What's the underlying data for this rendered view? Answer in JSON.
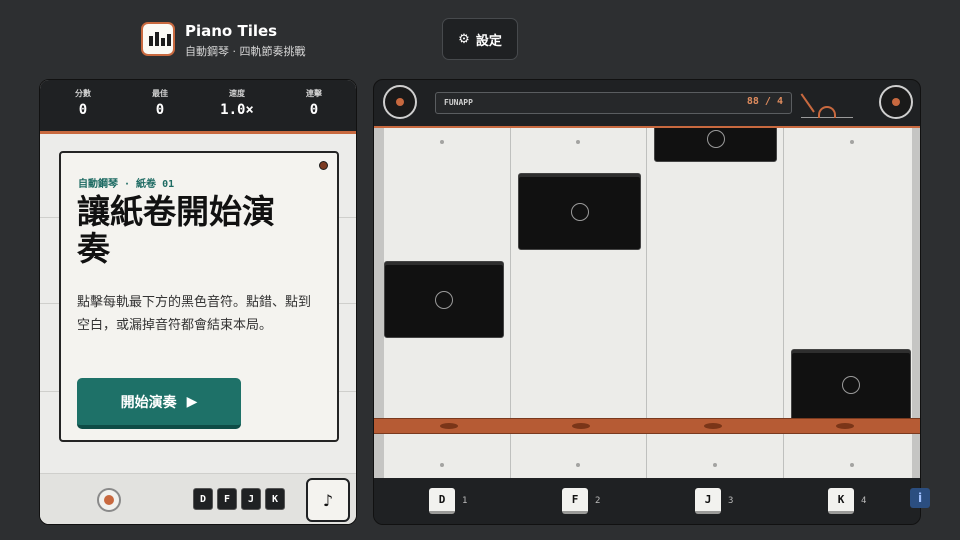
{
  "header": {
    "title": "Piano Tiles",
    "subtitle": "自動鋼琴 · 四軌節奏挑戰",
    "settings_label": "設定",
    "settings_icon": "gear-icon"
  },
  "stats": [
    {
      "label": "分數",
      "value": "0"
    },
    {
      "label": "最佳",
      "value": "0"
    },
    {
      "label": "速度",
      "value": "1.0×"
    },
    {
      "label": "連擊",
      "value": "0"
    }
  ],
  "card": {
    "kicker": "自動鋼琴 · 紙卷 01",
    "title": "讓紙卷開始演奏",
    "description": "點擊每軌最下方的黑色音符。點錯、點到空白，或漏掉音符都會結束本局。",
    "start_label": "開始演奏",
    "start_icon": "play-icon"
  },
  "left_footer": {
    "keys": [
      "D",
      "F",
      "J",
      "K"
    ],
    "music_icon": "♪"
  },
  "player": {
    "brand": "FUNAPP",
    "counter": "88 / 4"
  },
  "lanes": [
    {
      "key": "D",
      "num": "1"
    },
    {
      "key": "F",
      "num": "2"
    },
    {
      "key": "J",
      "num": "3"
    },
    {
      "key": "K",
      "num": "4"
    }
  ],
  "info_label": "i",
  "colors": {
    "accent": "#c8693f",
    "primary": "#1e7168",
    "dark": "#1f2123",
    "paper": "#ecece9"
  }
}
